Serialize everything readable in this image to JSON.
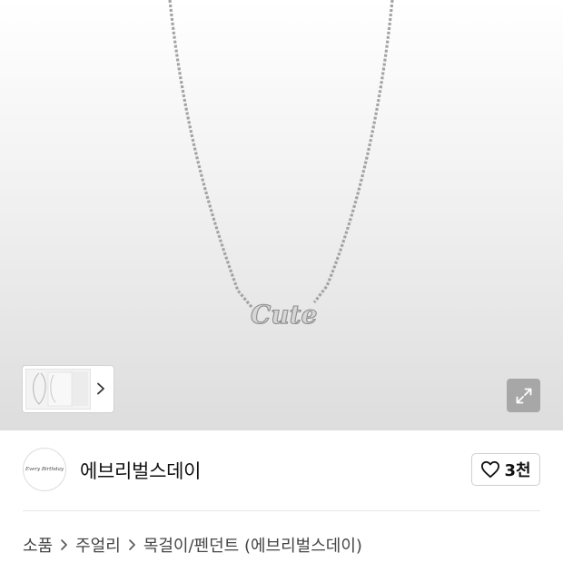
{
  "product_image": {
    "pendant_text": "Cute",
    "thumbnail_count_hint": 3
  },
  "icons": {
    "thumb_next": "chevron-right-icon",
    "expand": "expand-icon",
    "like": "heart-outline-icon",
    "breadcrumb_separator": "chevron-right-icon"
  },
  "brand": {
    "logo_text": "Every Birthday",
    "name": "에브리벌스데이",
    "like_count": "3천"
  },
  "breadcrumb": {
    "items": [
      "소품",
      "주얼리",
      "목걸이/펜던트 (에브리벌스데이)"
    ]
  },
  "colors": {
    "background": "#ffffff",
    "hero_gradient_bottom": "#dddddd",
    "text_primary": "#111111",
    "text_secondary": "#444444",
    "border": "#cfcfcf"
  }
}
